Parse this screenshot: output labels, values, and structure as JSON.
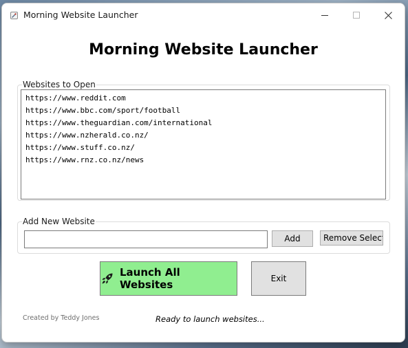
{
  "window": {
    "title": "Morning Website Launcher",
    "controls": [
      "minimize",
      "maximize",
      "close"
    ]
  },
  "heading": "Morning Website Launcher",
  "websites_group": {
    "label": "Websites to Open",
    "items": [
      "https://www.reddit.com",
      "https://www.bbc.com/sport/football",
      "https://www.theguardian.com/international",
      "https://www.nzherald.co.nz/",
      "https://www.stuff.co.nz/",
      "https://www.rnz.co.nz/news"
    ]
  },
  "add_group": {
    "label": "Add New Website",
    "input_value": "",
    "add_label": "Add",
    "remove_label": "Remove Selected"
  },
  "actions": {
    "launch_label": "Launch All Websites",
    "launch_icon": "rocket-icon",
    "launch_color": "#90ee90",
    "exit_label": "Exit"
  },
  "footer": {
    "credit": "Created by Teddy Jones",
    "status": "Ready to launch websites..."
  }
}
